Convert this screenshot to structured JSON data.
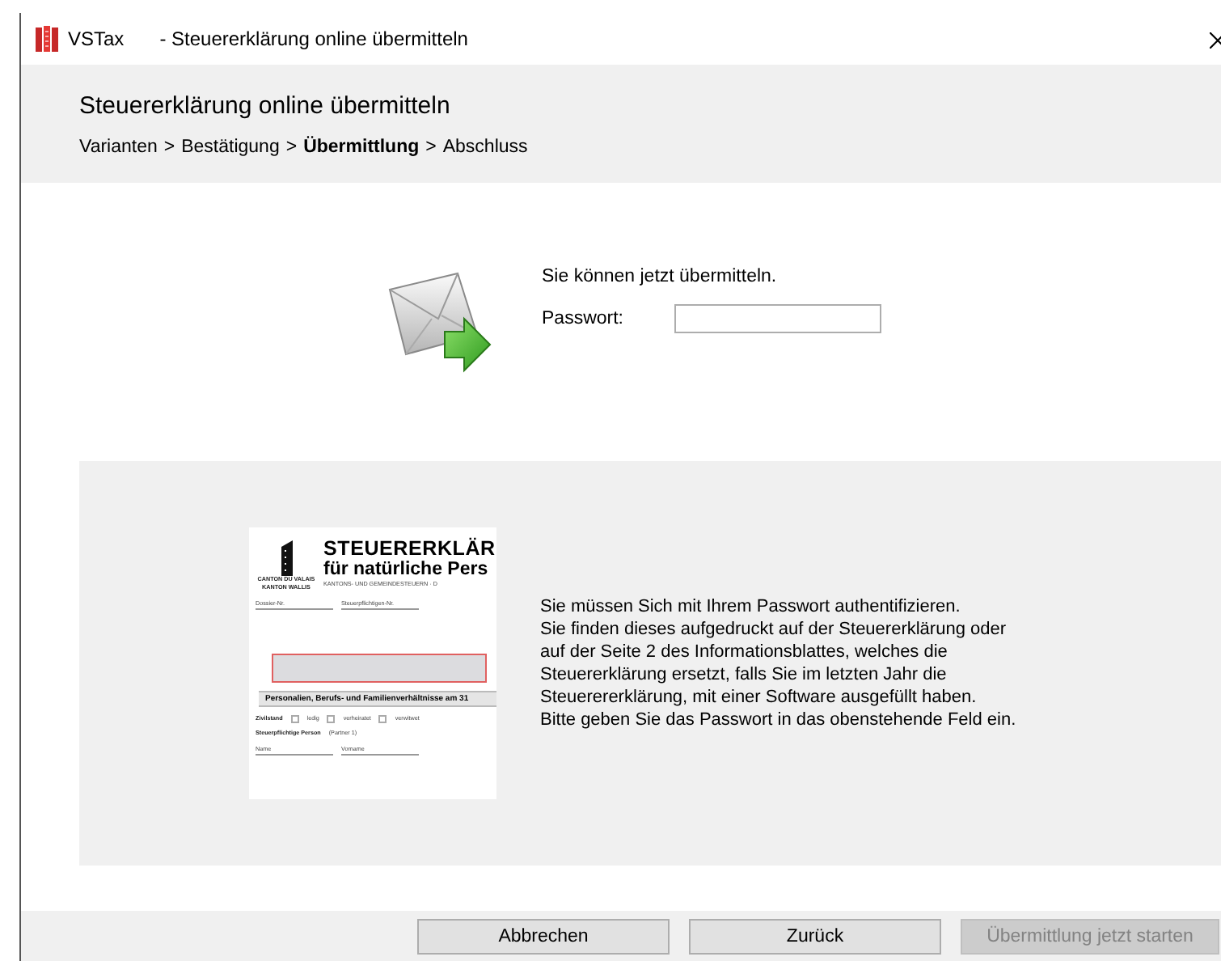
{
  "window": {
    "app_name": "VSTax",
    "title": "- Steuererklärung online übermitteln"
  },
  "header": {
    "title": "Steuererklärung online übermitteln",
    "steps": [
      {
        "label": "Varianten",
        "selected": false
      },
      {
        "label": "Bestätigung",
        "selected": false
      },
      {
        "label": "Übermittlung",
        "selected": true
      },
      {
        "label": "Abschluss",
        "selected": false
      }
    ],
    "separator": ">"
  },
  "transmit": {
    "message": "Sie können jetzt übermitteln.",
    "password_label": "Passwort:"
  },
  "info": {
    "document": {
      "heading": "STEUERERKLÄR",
      "subheading": "für natürliche Pers",
      "canton_lines": [
        "CANTON DU VALAIS",
        "KANTON WALLIS"
      ],
      "tax_line": "KANTONS- UND GEMEINDESTEUERN  ·  D",
      "dossier_label": "Dossier-Nr.",
      "taxpayer_no_label": "Steuerpflichtigen-Nr.",
      "section": "Personalien, Berufs- und Familienverhältnisse am 31",
      "civil_status_label": "Zivilstand",
      "civil_options": [
        "ledig",
        "verheiratet",
        "verwitwet"
      ],
      "person_label": "Steuerpflichtige Person",
      "person_note": "(Partner 1)",
      "name_label": "Name",
      "first_name_label": "Vorname"
    },
    "lines": [
      "Sie müssen Sich mit Ihrem Passwort authentifizieren.",
      "Sie finden dieses aufgedruckt auf der Steuererklärung oder",
      "auf der Seite 2 des Informationsblattes, welches die",
      "Steuererklärung ersetzt, falls Sie im letzten Jahr die",
      "Steuerererklärung, mit einer Software ausgefüllt haben.",
      "Bitte geben Sie das Passwort in das obenstehende Feld ein."
    ]
  },
  "buttons": [
    {
      "label": "Abbrechen",
      "disabled": false
    },
    {
      "label": "Zurück",
      "disabled": false
    },
    {
      "label": "Übermittlung jetzt starten",
      "disabled": true
    }
  ]
}
